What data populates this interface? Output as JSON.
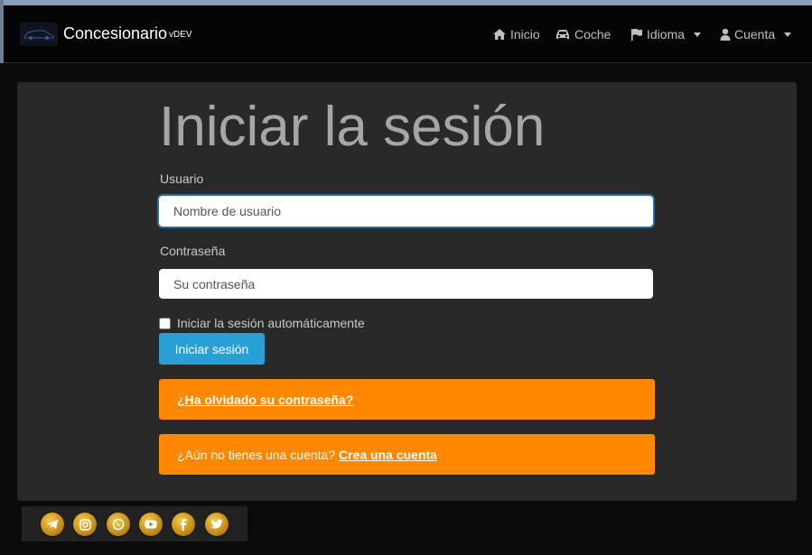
{
  "brand": {
    "name": "Concesionario",
    "suffix": "vDEV"
  },
  "nav": {
    "home": "Inicio",
    "car": "Coche",
    "language": "Idioma",
    "account": "Cuenta"
  },
  "login": {
    "title": "Iniciar la sesión",
    "username_label": "Usuario",
    "username_placeholder": "Nombre de usuario",
    "password_label": "Contraseña",
    "password_placeholder": "Su contraseña",
    "remember_label": "Iniciar la sesión automáticamente",
    "submit_label": "Iniciar sesión",
    "forgot_link": "¿Ha olvidado su contraseña?",
    "no_account_text": "¿Aún no tienes una cuenta?",
    "create_account_link": "Crea una cuenta"
  },
  "social": [
    "telegram-icon",
    "instagram-icon",
    "whatsapp-icon",
    "youtube-icon",
    "facebook-icon",
    "twitter-icon"
  ],
  "colors": {
    "accent": "#2a9fd6",
    "warning": "#ff8800",
    "card_bg": "#292929",
    "navbar_bg": "#050505"
  }
}
